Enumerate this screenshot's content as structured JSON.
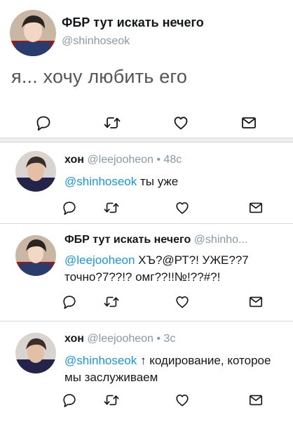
{
  "main": {
    "name": "ФБР тут искать нечего",
    "handle": "@shinhoseok",
    "text": "я... хочу любить его"
  },
  "replies": [
    {
      "name": "хон",
      "meta": "@leejooheon • 48с",
      "mention": "@shinhoseok",
      "text": " ты уже"
    },
    {
      "name": "ФБР тут искать нечего",
      "meta": "@shinho...",
      "mention": "@leejooheon",
      "text": " ХЪ?@РТ?! УЖЕ??7 точно?7??!? омг??!!№!??#?!"
    },
    {
      "name": "хон",
      "meta": "@leejooheon • 3с",
      "mention": "@shinhoseok",
      "text": " ↑ кодирование, которое мы заслуживаем"
    }
  ],
  "icons": [
    "reply-icon",
    "retweet-icon",
    "like-icon",
    "message-icon"
  ],
  "colors": {
    "icon": "#14171a",
    "mention": "#1b95e0",
    "handle": "#8899a6",
    "divider": "#d8d8d8"
  }
}
